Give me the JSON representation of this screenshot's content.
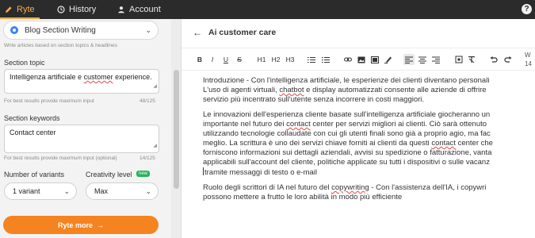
{
  "nav": {
    "tabs": [
      {
        "label": "Ryte",
        "icon": "pencil-icon",
        "active": true
      },
      {
        "label": "History",
        "icon": "clock-icon"
      },
      {
        "label": "Account",
        "icon": "person-icon"
      }
    ],
    "help": "?"
  },
  "left": {
    "use_case": "Blog Section Writing",
    "use_case_hint": "Write articles based on section topics & headlines",
    "section_topic": {
      "label": "Section topic",
      "value_plain": "Intelligenza artificiale e ",
      "value_flag": "customer",
      "value_rest": " experience.",
      "hint": "For best results provide maximum input",
      "counter": "48/125"
    },
    "section_keywords": {
      "label": "Section keywords",
      "value": "Contact center",
      "hint": "For best results provide maximum input (optional)",
      "counter": "14/125"
    },
    "variants": {
      "label": "Number of variants",
      "value": "1 variant"
    },
    "creativity": {
      "label": "Creativity level",
      "badge": "new",
      "value": "Max"
    },
    "submit": "Ryte more",
    "submit_arrow": "→"
  },
  "editor": {
    "title": "Ai customer care",
    "word_count": [
      "W",
      "14"
    ],
    "toolbar": [
      "B",
      "I",
      "U",
      "S",
      "H1",
      "H2",
      "H3"
    ],
    "paragraphs": [
      [
        "Introduzione - Con l'intelligenza artificiale, le esperienze dei clienti diventano personali",
        "L'uso di agenti virtuali, ",
        "chatbot",
        " e display automatizzati consente alle aziende di offrire",
        "servizio più incentrato sull'utente senza incorrere in costi maggiori."
      ],
      [
        "Le innovazioni dell'esperienza cliente basate sull'intelligenza artificiale giocheranno un",
        "importante nel futuro dei ",
        "contact",
        " center per servizi migliori ai clienti. Ciò sarà ottenuto",
        "utilizzando tecnologie collaudate con cui gli utenti finali sono già a proprio agio, ma fac",
        "meglio. La scrittura è uno dei servizi chiave forniti ai clienti da questi ",
        "contact",
        " center che",
        "forniscono informazioni sui dettagli aziendali, avvisi su spedizione o fatturazione, vanta",
        "applicabili sull'account del cliente, politiche applicate su tutti i dispositivi o sulle vacanz",
        "tramite messaggi di testo o e-mail"
      ],
      [
        "Ruolo degli scrittori di IA nel futuro del ",
        "copywriting",
        " - Con l'assistenza dell'IA, i copywri",
        "possono mettere a frutto le loro abilità in modo più efficiente"
      ]
    ]
  }
}
